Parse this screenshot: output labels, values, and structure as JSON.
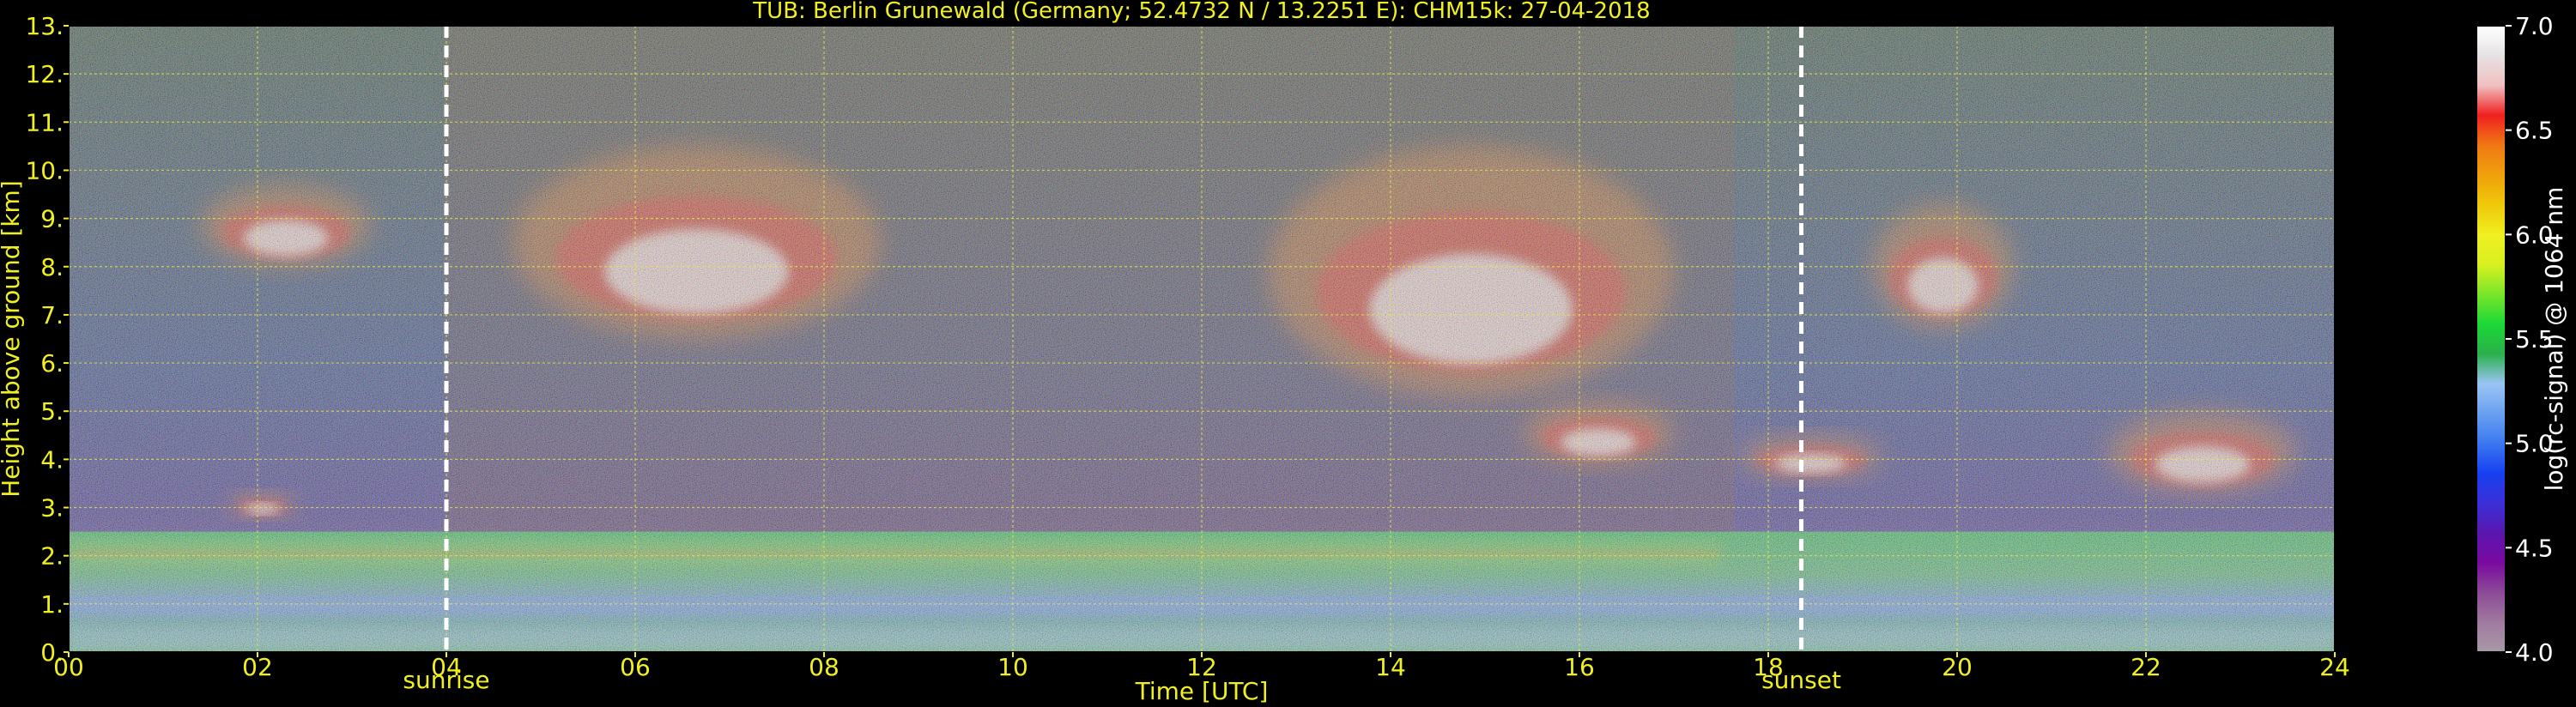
{
  "chart_data": {
    "type": "heatmap",
    "title": "TUB: Berlin Grunewald (Germany; 52.4732 N / 13.2251 E):    CHM15k: 27-04-2018",
    "xlabel": "Time [UTC]",
    "ylabel": "Height above ground [km]",
    "xlim": [
      0,
      24
    ],
    "ylim": [
      0,
      13
    ],
    "x_ticks": [
      "00",
      "02",
      "04",
      "06",
      "08",
      "10",
      "12",
      "14",
      "16",
      "18",
      "20",
      "22",
      "24"
    ],
    "y_ticks": [
      "0.",
      "1.",
      "2.",
      "3.",
      "4.",
      "5.",
      "6.",
      "7.",
      "8.",
      "9.",
      "10.",
      "11.",
      "12.",
      "13."
    ],
    "grid": true,
    "colorbar": {
      "label": "log(rc-signal) @ 1064 nm",
      "range": [
        4.0,
        7.0
      ],
      "ticks": [
        "4.0",
        "4.5",
        "5.0",
        "5.5",
        "6.0",
        "6.5",
        "7.0"
      ],
      "colors": [
        "#a89aa8",
        "#a07aa0",
        "#8c4a96",
        "#7a0aa0",
        "#5a16b0",
        "#3a30d8",
        "#1640f0",
        "#3c78f0",
        "#6aa0f0",
        "#9ac4f4",
        "#2ab04a",
        "#1cd836",
        "#7ae62a",
        "#d8f020",
        "#f0f020",
        "#f0c80a",
        "#f0a00a",
        "#f07814",
        "#f02020",
        "#f0c0c0",
        "#e6e2e4",
        "#ffffff"
      ]
    },
    "annotations": [
      {
        "label": "sunrise",
        "x": 4.0
      },
      {
        "label": "sunset",
        "x": 18.35
      }
    ],
    "features": [
      {
        "kind": "boundary_layer",
        "x": [
          0,
          24
        ],
        "y": [
          0,
          2.5
        ]
      },
      {
        "kind": "aerosol_layer",
        "x": [
          0,
          17.5
        ],
        "y": [
          1.8,
          2.3
        ]
      },
      {
        "kind": "cloud",
        "x": [
          1.4,
          3.2
        ],
        "y": [
          8.0,
          9.7
        ]
      },
      {
        "kind": "cloud",
        "x": [
          1.7,
          2.4
        ],
        "y": [
          2.8,
          3.3
        ]
      },
      {
        "kind": "cloud",
        "x": [
          4.7,
          8.6
        ],
        "y": [
          6.5,
          10.5
        ]
      },
      {
        "kind": "cloud",
        "x": [
          12.7,
          17.0
        ],
        "y": [
          5.3,
          10.5
        ]
      },
      {
        "kind": "cloud",
        "x": [
          15.4,
          17.0
        ],
        "y": [
          3.9,
          5.2
        ]
      },
      {
        "kind": "cloud",
        "x": [
          17.7,
          19.2
        ],
        "y": [
          3.6,
          4.5
        ]
      },
      {
        "kind": "cloud",
        "x": [
          19.1,
          20.6
        ],
        "y": [
          6.7,
          9.3
        ]
      },
      {
        "kind": "cloud",
        "x": [
          21.6,
          23.6
        ],
        "y": [
          3.3,
          5.0
        ]
      }
    ]
  }
}
